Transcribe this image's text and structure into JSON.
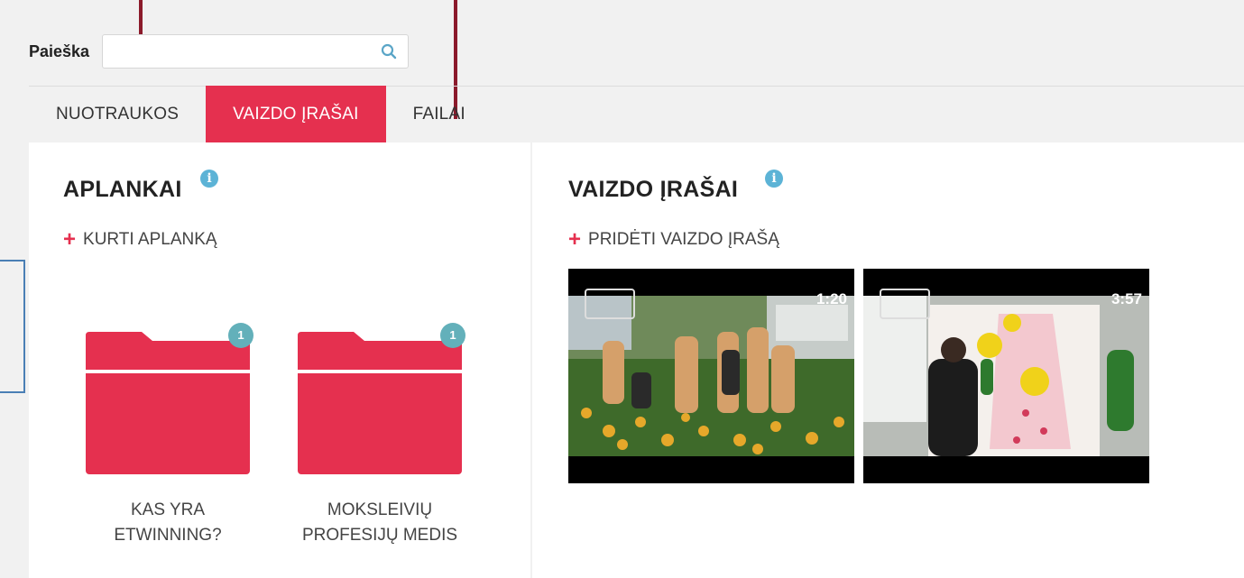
{
  "search": {
    "label": "Paieška",
    "value": "",
    "placeholder": ""
  },
  "tabs": [
    {
      "label": "NUOTRAUKOS",
      "active": false
    },
    {
      "label": "VAIZDO ĮRAŠAI",
      "active": true
    },
    {
      "label": "FAILAI",
      "active": false
    }
  ],
  "folders_panel": {
    "title": "APLANKAI",
    "add_label": "KURTI APLANKĄ",
    "folders": [
      {
        "label": "KAS YRA\nETWINNING?",
        "badge": "1"
      },
      {
        "label": "MOKSLEIVIŲ\nPROFESIJŲ MEDIS",
        "badge": "1"
      }
    ]
  },
  "videos_panel": {
    "title": "VAIZDO ĮRAŠAI",
    "add_label": "PRIDĖTI VAIZDO ĮRAŠĄ",
    "videos": [
      {
        "duration": "1:20"
      },
      {
        "duration": "3:57"
      }
    ]
  },
  "icons": {
    "search": "search-icon",
    "info": "info-icon",
    "add": "plus-icon",
    "folder": "folder-icon",
    "play": "play-icon"
  },
  "colors": {
    "accent": "#e5304f",
    "info": "#5cb3d6",
    "badge": "#63b0ba",
    "annotation": "#8b1a2b",
    "annotation_box": "#4a7fb5"
  }
}
